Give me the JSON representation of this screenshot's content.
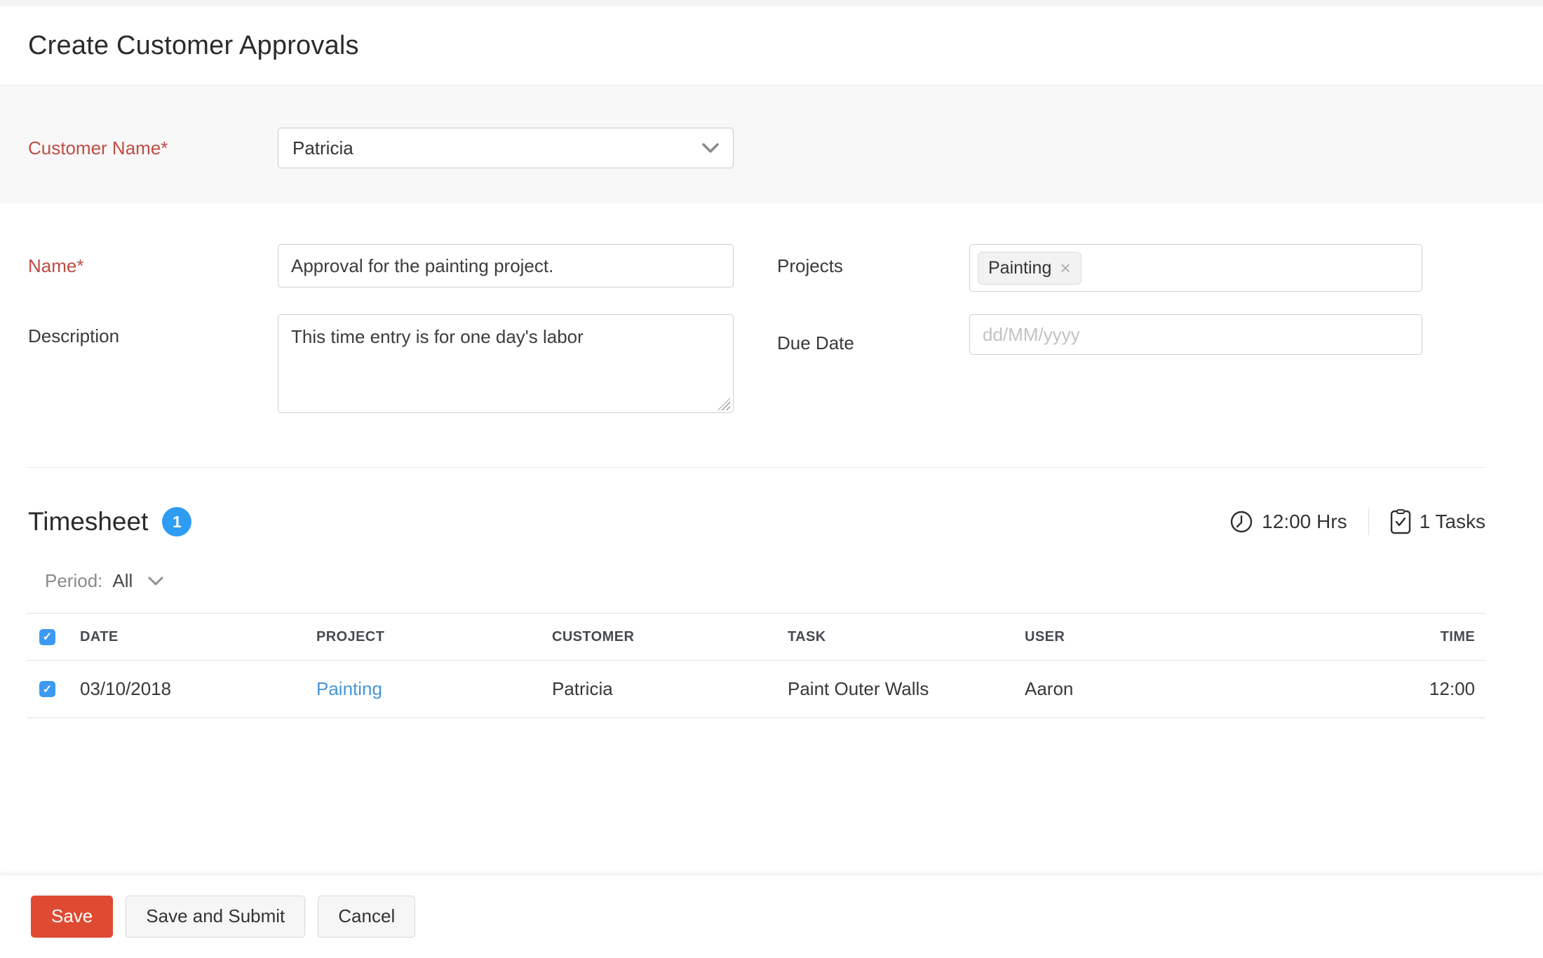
{
  "page": {
    "title": "Create Customer Approvals"
  },
  "form": {
    "customer_name": {
      "label": "Customer Name*",
      "value": "Patricia"
    },
    "name": {
      "label": "Name*",
      "value": "Approval for the painting project."
    },
    "description": {
      "label": "Description",
      "value": "This time entry is for one day's labor"
    },
    "projects": {
      "label": "Projects",
      "tags": [
        "Painting"
      ]
    },
    "due_date": {
      "label": "Due Date",
      "placeholder": "dd/MM/yyyy"
    }
  },
  "timesheet": {
    "heading": "Timesheet",
    "badge_count": "1",
    "total_hours": "12:00 Hrs",
    "total_tasks": "1 Tasks",
    "period_label": "Period:",
    "period_value": "All",
    "table": {
      "columns": [
        "DATE",
        "PROJECT",
        "CUSTOMER",
        "TASK",
        "USER",
        "TIME"
      ],
      "rows": [
        {
          "checked": true,
          "date": "03/10/2018",
          "project": "Painting",
          "customer": "Patricia",
          "task": "Paint Outer Walls",
          "user": "Aaron",
          "time": "12:00"
        }
      ]
    }
  },
  "footer": {
    "save_label": "Save",
    "save_and_submit_label": "Save and Submit",
    "cancel_label": "Cancel"
  },
  "icons": {
    "select_chevron": "chevron-down",
    "period_chevron": "chevron-down",
    "hours_icon": "clock",
    "tasks_icon": "clipboard-check",
    "tag_remove": "×",
    "checkbox_check": "✓"
  },
  "colors": {
    "accent_red": "#df4a32",
    "required_label_red": "#bf4c42",
    "badge_blue": "#2f9cf4",
    "checkbox_blue": "#3d9af2",
    "link_blue": "#4596d8",
    "band_gray": "#f8f8f8"
  }
}
